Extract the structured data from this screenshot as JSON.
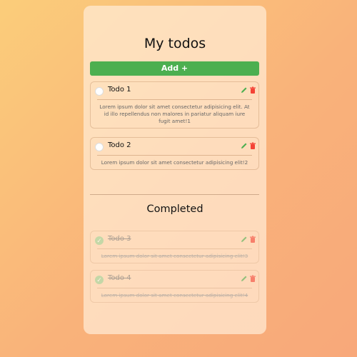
{
  "page": {
    "title": "My todos",
    "add_label": "Add +",
    "completed_title": "Completed"
  },
  "todos": [
    {
      "title": "Todo 1",
      "description": "Lorem ipsum dolor sit amet consectetur adipisicing elit. At id illo repellendus non malores in pariatur aliquam iure fugit amet!1",
      "completed": false
    },
    {
      "title": "Todo 2",
      "description": "Lorem ipsum dolor sit amet consectetur adipisicing elit!2",
      "completed": false
    }
  ],
  "completed": [
    {
      "title": "Todo 3",
      "description": "Lorem ipsum dolor sit amet consectetur adipisicing elit!3",
      "completed": true
    },
    {
      "title": "Todo 4",
      "description": "Lorem ipsum dolor sit amet consectetur adipisicing elit!4",
      "completed": true
    }
  ],
  "icons": {
    "checkbox": "circle-checkbox-icon",
    "checked": "check-icon",
    "edit": "pencil-icon",
    "delete": "trash-icon"
  },
  "colors": {
    "add_button": "#4caf50",
    "edit_icon": "#4caf50",
    "delete_icon": "#f44336",
    "checked": "#9fd59a"
  }
}
